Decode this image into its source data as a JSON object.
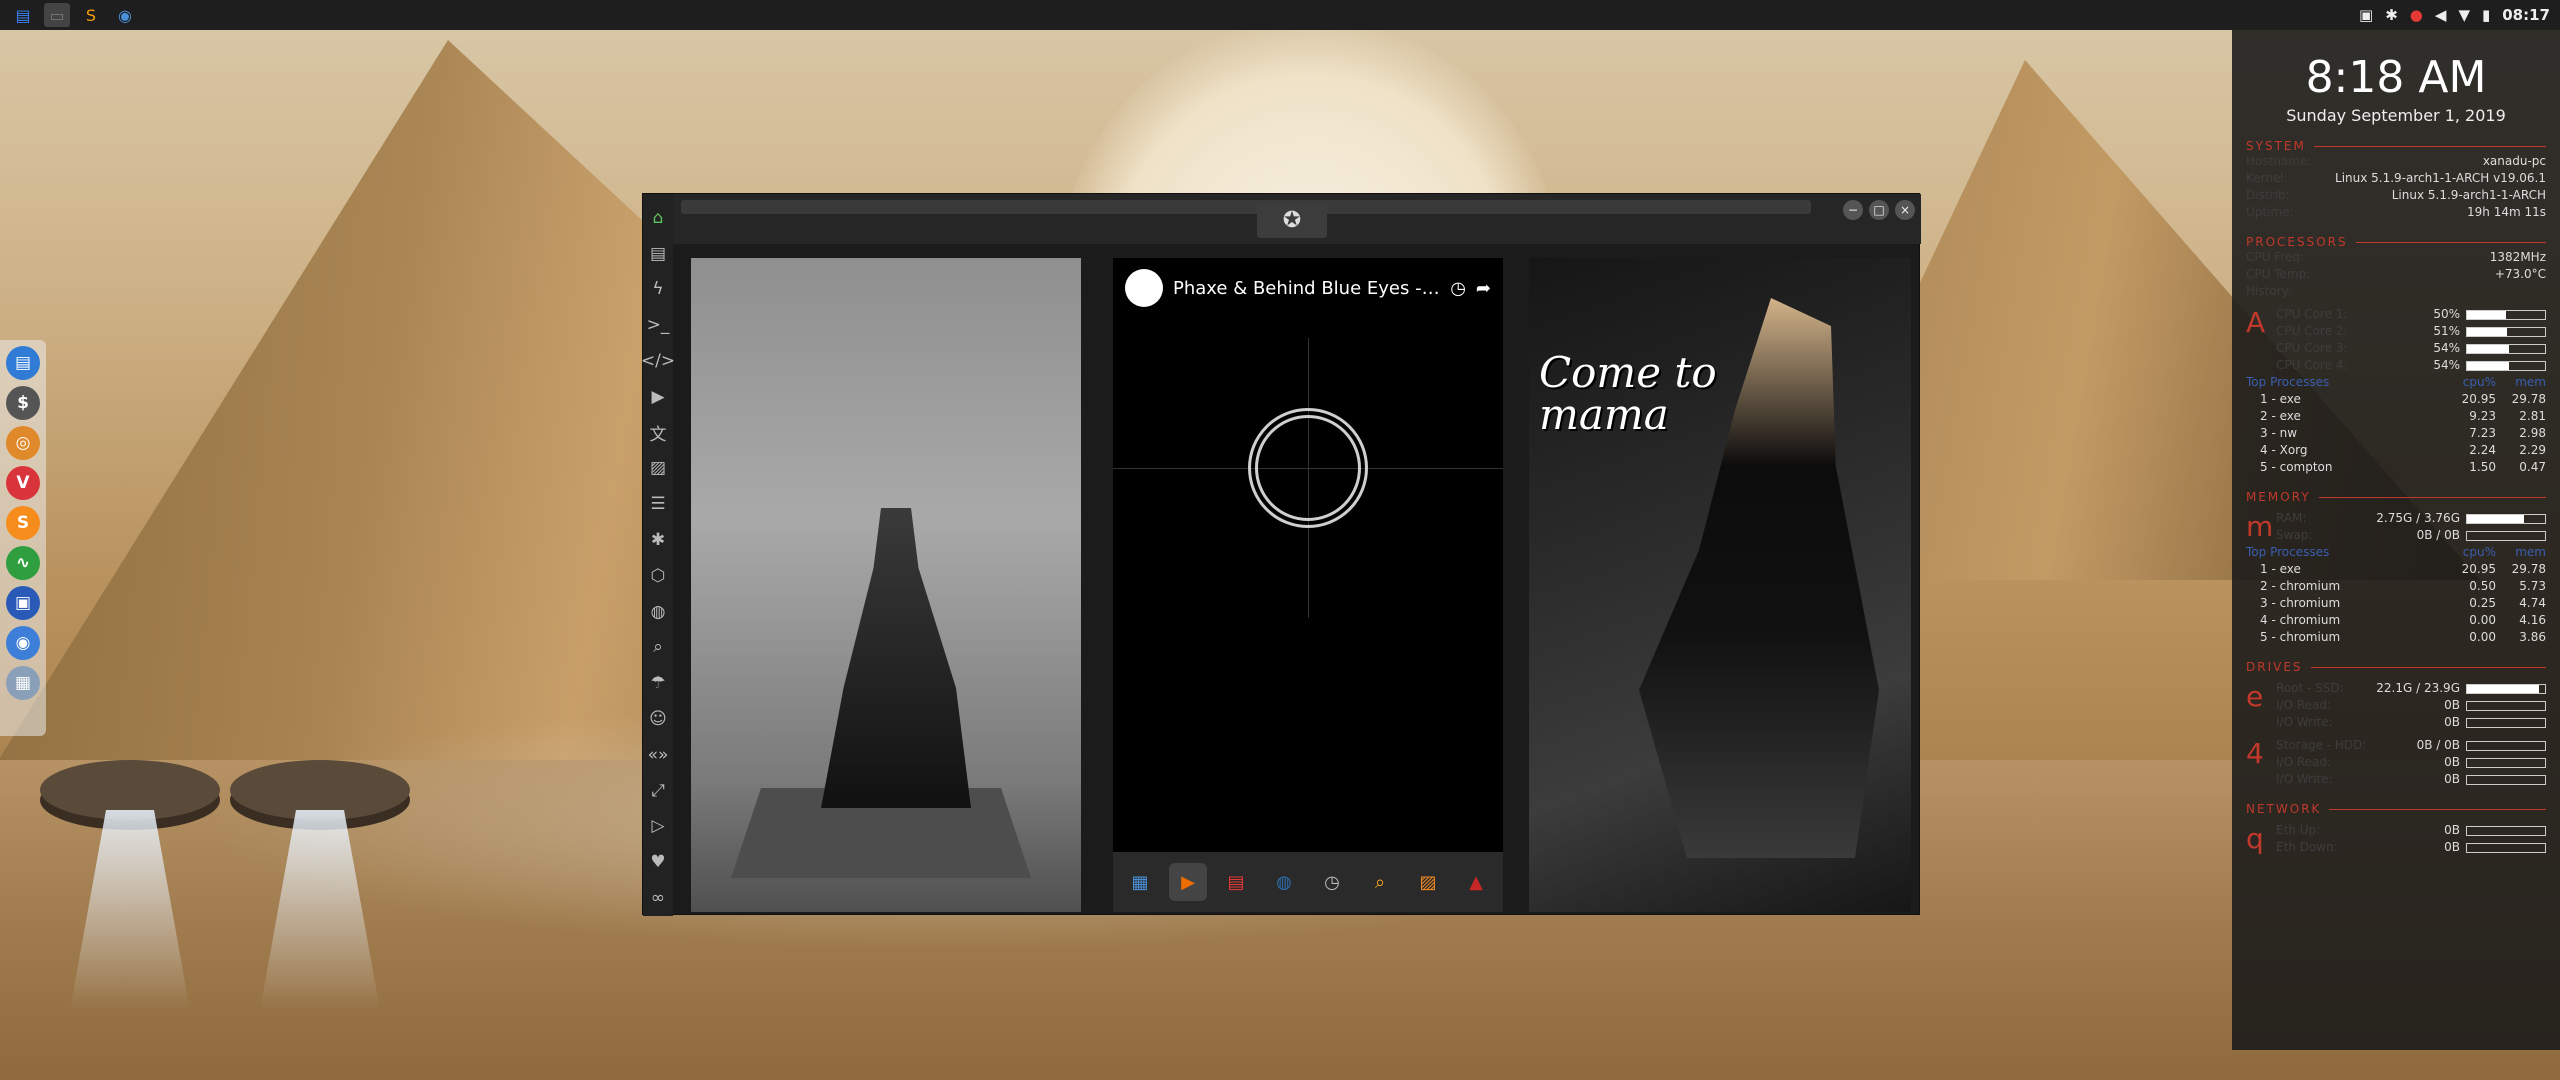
{
  "top_panel": {
    "apps": [
      {
        "name": "files-icon",
        "glyph": "▤",
        "color": "#3b82f6"
      },
      {
        "name": "terminal-icon",
        "glyph": "▭",
        "color": "#777777"
      },
      {
        "name": "sublime-icon",
        "glyph": "S",
        "color": "#f59e0b"
      },
      {
        "name": "chrome-icon",
        "glyph": "◉",
        "color": "#4a90d9"
      }
    ],
    "clock": "08:17"
  },
  "dock": {
    "items": [
      {
        "name": "files-dock-icon",
        "glyph": "▤",
        "color": "#2f7bd6"
      },
      {
        "name": "dollar-dock-icon",
        "glyph": "$",
        "color": "#555555"
      },
      {
        "name": "blender-dock-icon",
        "glyph": "◎",
        "color": "#e0892a"
      },
      {
        "name": "vivaldi-dock-icon",
        "glyph": "V",
        "color": "#d9343b"
      },
      {
        "name": "sublime-dock-icon",
        "glyph": "S",
        "color": "#f58c1b"
      },
      {
        "name": "monitor-dock-icon",
        "glyph": "∿",
        "color": "#2e9e3e"
      },
      {
        "name": "screen-dock-icon",
        "glyph": "▣",
        "color": "#2a5ab8"
      },
      {
        "name": "chromium-dock-icon",
        "glyph": "◉",
        "color": "#3d7fd8"
      },
      {
        "name": "grid-dock-icon",
        "glyph": "▦",
        "color": "#8aa0b8"
      }
    ]
  },
  "window": {
    "youtube_title": "Phaxe & Behind Blue Eyes - ...",
    "overlay_text_line1": "Come to",
    "overlay_text_line2": "mama",
    "sidebar_icons": [
      "home-icon",
      "document-icon",
      "lightning-icon",
      "terminal-prompt-icon",
      "code-icon",
      "play-icon",
      "translate-icon",
      "image-icon",
      "news-icon",
      "asterisk-icon",
      "hexagon-icon",
      "globe-icon",
      "search-icon",
      "umbrella-icon",
      "contacts-icon",
      "chevrons-icon",
      "expand-icon",
      "youtube-icon",
      "heart-icon",
      "infinity-icon"
    ],
    "taskbar_icons": [
      "calculator-icon",
      "play-arrow-icon",
      "calendar-icon",
      "globe-icon",
      "clock-icon",
      "magnifier-icon",
      "photos-icon",
      "pdf-icon"
    ]
  },
  "conky": {
    "time": "8:18 AM",
    "date": "Sunday September  1, 2019",
    "system": {
      "title": "SYSTEM",
      "rows": [
        {
          "k": "Hostname:",
          "v": "xanadu-pc"
        },
        {
          "k": "Kernel:",
          "v": "Linux 5.1.9-arch1-1-ARCH v19.06.1"
        },
        {
          "k": "Distrib:",
          "v": "Linux 5.1.9-arch1-1-ARCH"
        },
        {
          "k": "Uptime:",
          "v": "19h 14m 11s"
        }
      ]
    },
    "processors": {
      "title": "PROCESSORS",
      "rows": [
        {
          "k": "CPU Freq:",
          "v": "1382MHz"
        },
        {
          "k": "CPU Temp:",
          "v": "+73.0°C"
        },
        {
          "k": "History:",
          "v": ""
        }
      ],
      "letter": "A",
      "cores": [
        {
          "k": "CPU Core 1:",
          "v": "50%",
          "pct": 0.5
        },
        {
          "k": "CPU Core 2:",
          "v": "51%",
          "pct": 0.51
        },
        {
          "k": "CPU Core 3:",
          "v": "54%",
          "pct": 0.54
        },
        {
          "k": "CPU Core 4:",
          "v": "54%",
          "pct": 0.54
        }
      ],
      "top_title": "Top Processes",
      "col_a": "cpu%",
      "col_b": "mem",
      "top": [
        {
          "n": "1 - exe",
          "a": "20.95",
          "b": "29.78"
        },
        {
          "n": "2 - exe",
          "a": "9.23",
          "b": "2.81"
        },
        {
          "n": "3 - nw",
          "a": "7.23",
          "b": "2.98"
        },
        {
          "n": "4 - Xorg",
          "a": "2.24",
          "b": "2.29"
        },
        {
          "n": "5 - compton",
          "a": "1.50",
          "b": "0.47"
        }
      ]
    },
    "memory": {
      "title": "MEMORY",
      "letter": "m",
      "rows": [
        {
          "k": "RAM:",
          "v": "2.75G / 3.76G",
          "pct": 0.73
        },
        {
          "k": "Swap:",
          "v": "0B / 0B",
          "pct": 0
        }
      ],
      "top_title": "Top Processes",
      "col_a": "cpu%",
      "col_b": "mem",
      "top": [
        {
          "n": "1 - exe",
          "a": "20.95",
          "b": "29.78"
        },
        {
          "n": "2 - chromium",
          "a": "0.50",
          "b": "5.73"
        },
        {
          "n": "3 - chromium",
          "a": "0.25",
          "b": "4.74"
        },
        {
          "n": "4 - chromium",
          "a": "0.00",
          "b": "4.16"
        },
        {
          "n": "5 - chromium",
          "a": "0.00",
          "b": "3.86"
        }
      ]
    },
    "drives": {
      "title": "DRIVES",
      "root_letter": "e",
      "root": [
        {
          "k": "Root - SSD:",
          "v": "22.1G / 23.9G",
          "pct": 0.92
        },
        {
          "k": "I/O Read:",
          "v": "0B",
          "pct": 0
        },
        {
          "k": "I/O Write:",
          "v": "0B",
          "pct": 0
        }
      ],
      "storage_letter": "4",
      "storage": [
        {
          "k": "Storage - HDD:",
          "v": "0B / 0B",
          "pct": 0
        },
        {
          "k": "I/O Read:",
          "v": "0B",
          "pct": 0
        },
        {
          "k": "I/O Write:",
          "v": "0B",
          "pct": 0
        }
      ]
    },
    "network": {
      "title": "NETWORK",
      "letter": "q",
      "rows": [
        {
          "k": "Eth Up:",
          "v": "0B",
          "pct": 0
        },
        {
          "k": "Eth Down:",
          "v": "0B",
          "pct": 0
        }
      ]
    }
  }
}
